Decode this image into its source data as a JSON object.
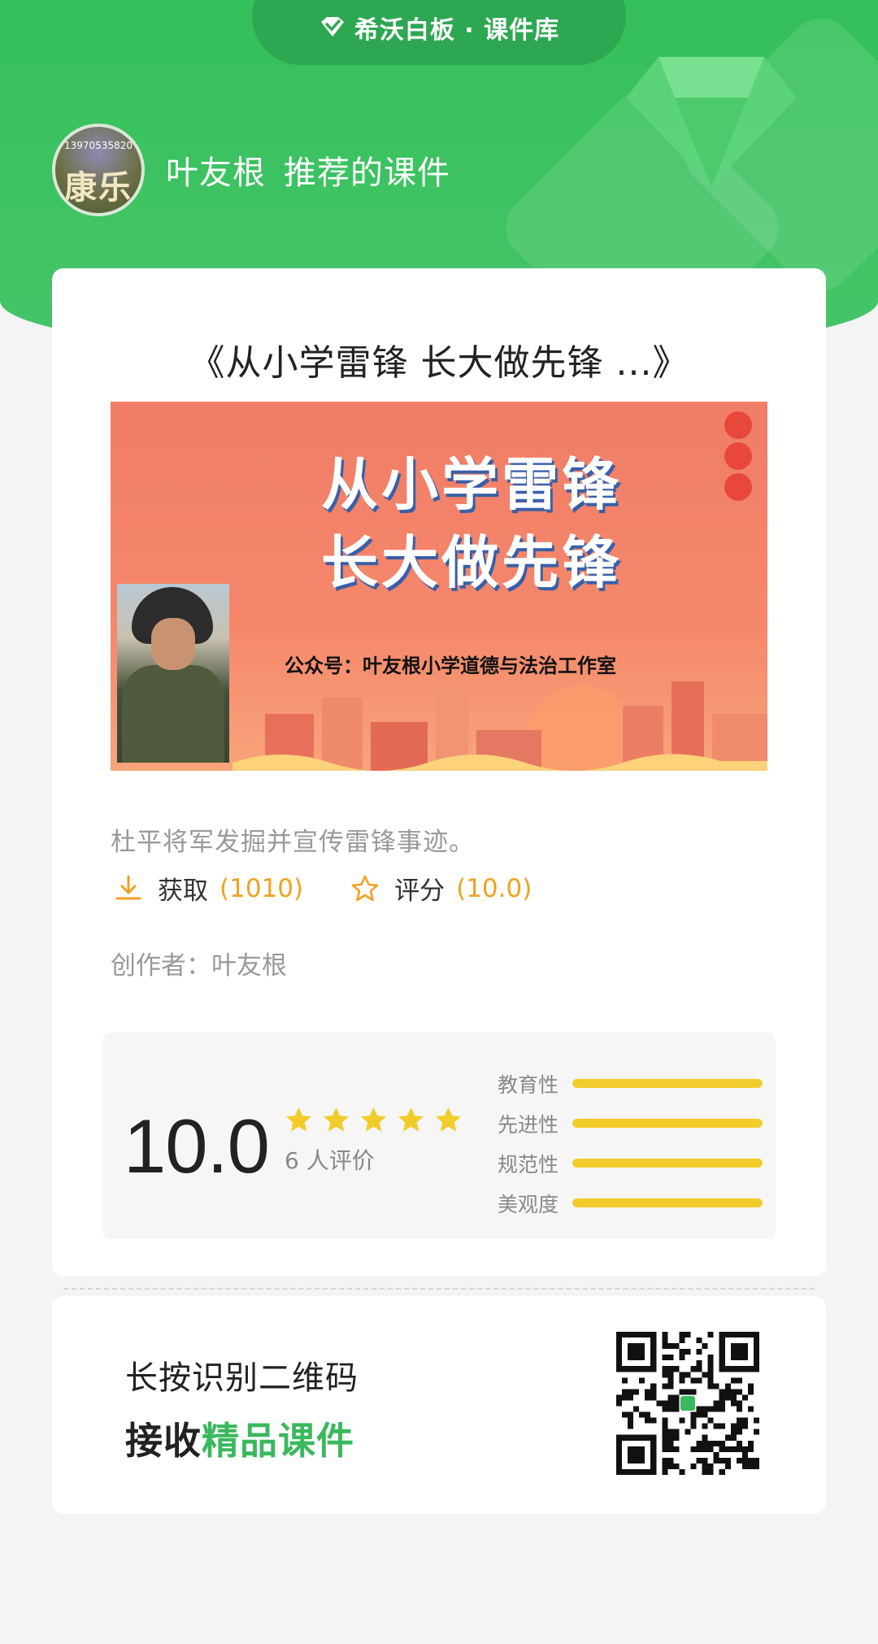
{
  "header": {
    "brand": "希沃白板 · 课件库",
    "user_name": "叶友根",
    "recommend_text": "推荐的课件",
    "avatar_phone": "13970535820",
    "avatar_chars": "康乐"
  },
  "course": {
    "title": "《从小学雷锋 长大做先锋 ...》",
    "banner_line1": "从小学雷锋",
    "banner_line2": "长大做先锋",
    "banner_sub": "公众号：叶友根小学道德与法治工作室",
    "description": "杜平将军发掘并宣传雷锋事迹。",
    "get_label": "获取",
    "get_count": "(1010)",
    "rate_label": "评分",
    "rate_value": "(10.0)",
    "author": "创作者：叶友根"
  },
  "rating": {
    "score": "10.0",
    "stars": 5,
    "reviews": "6 人评价",
    "dimensions": [
      {
        "label": "教育性",
        "level": 1.0
      },
      {
        "label": "先进性",
        "level": 1.0
      },
      {
        "label": "规范性",
        "level": 1.0
      },
      {
        "label": "美观度",
        "level": 1.0
      }
    ]
  },
  "qr": {
    "line1": "长按识别二维码",
    "line2_plain": "接收",
    "line2_highlight": "精品课件"
  },
  "colors": {
    "brand_green": "#3fc363",
    "accent_orange": "#f0a21d",
    "star_yellow": "#f2cc2a",
    "highlight_green": "#3ab85d"
  }
}
